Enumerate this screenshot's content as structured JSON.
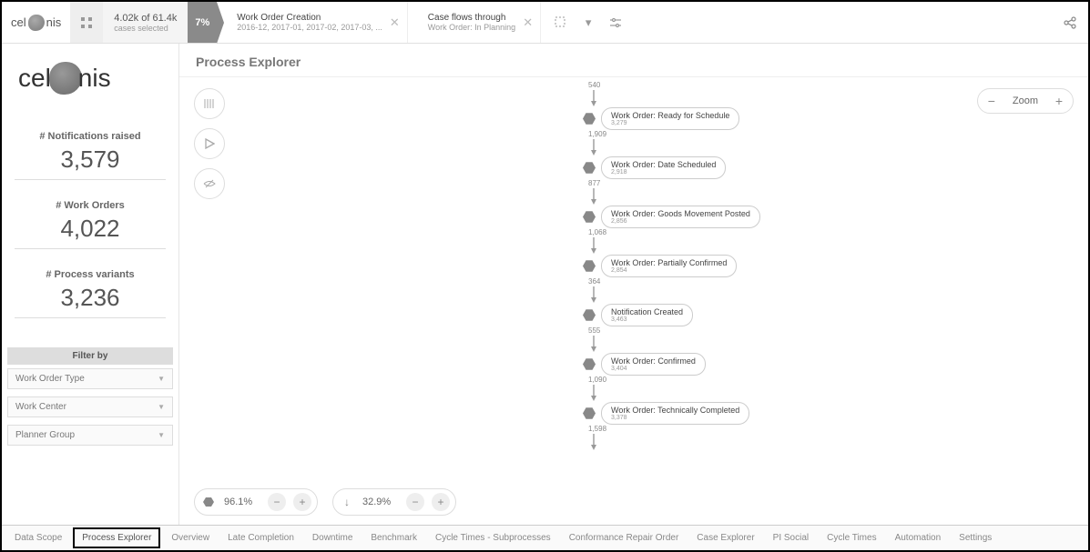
{
  "topbar": {
    "logo_text": "celonis",
    "cases_line1": "4.02k of 61.4k",
    "cases_line2": "cases selected",
    "percent": "7%",
    "filters": [
      {
        "l1": "Work Order Creation",
        "l2": "2016-12, 2017-01, 2017-02, 2017-03, ..."
      },
      {
        "l1": "Case flows through",
        "l2": "Work Order: In Planning"
      }
    ]
  },
  "sidebar": {
    "logo_text": "celonis",
    "kpis": [
      {
        "label": "# Notifications raised",
        "value": "3,579"
      },
      {
        "label": "# Work Orders",
        "value": "4,022"
      },
      {
        "label": "# Process variants",
        "value": "3,236"
      }
    ],
    "filter_header": "Filter by",
    "filter_dds": [
      "Work Order Type",
      "Work Center",
      "Planner Group"
    ]
  },
  "main": {
    "title": "Process Explorer",
    "zoom_label": "Zoom",
    "flow": {
      "start_count": "540",
      "nodes": [
        {
          "label": "Work Order: Ready for Schedule",
          "count": "3,279",
          "edge_out": "1,909"
        },
        {
          "label": "Work Order: Date Scheduled",
          "count": "2,918",
          "edge_out": "877"
        },
        {
          "label": "Work Order: Goods Movement Posted",
          "count": "2,856",
          "edge_out": "1,068"
        },
        {
          "label": "Work Order: Partially Confirmed",
          "count": "2,854",
          "edge_out": "364"
        },
        {
          "label": "Notification Created",
          "count": "3,463",
          "edge_out": "555"
        },
        {
          "label": "Work Order: Confirmed",
          "count": "3,404",
          "edge_out": "1,090"
        },
        {
          "label": "Work Order: Technically Completed",
          "count": "3,378",
          "edge_out": "1,598"
        }
      ]
    },
    "sliders": {
      "activities_pct": "96.1%",
      "connections_pct": "32.9%"
    }
  },
  "tabs": [
    "Data Scope",
    "Process Explorer",
    "Overview",
    "Late Completion",
    "Downtime",
    "Benchmark",
    "Cycle Times - Subprocesses",
    "Conformance Repair Order",
    "Case Explorer",
    "PI Social",
    "Cycle Times",
    "Automation",
    "Settings"
  ],
  "active_tab": "Process Explorer"
}
